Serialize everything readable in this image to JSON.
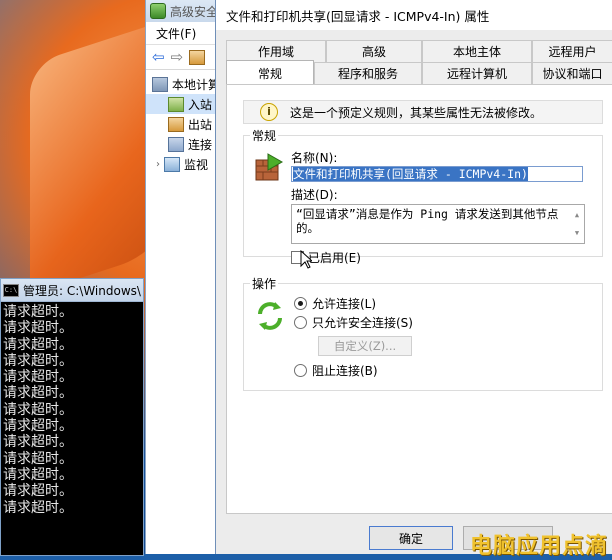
{
  "console": {
    "title": "管理员: C:\\Windows\\",
    "icon": "cmd-icon",
    "lines": [
      "请求超时。",
      "请求超时。",
      "请求超时。",
      "请求超时。",
      "请求超时。",
      "请求超时。",
      "请求超时。",
      "请求超时。",
      "请求超时。",
      "请求超时。",
      "请求超时。",
      "请求超时。",
      "请求超时。"
    ]
  },
  "mmc": {
    "title": "高级安全",
    "menu_file": "文件(F)",
    "tree": [
      {
        "label": "本地计算",
        "icon": "computer-icon"
      },
      {
        "label": "入站",
        "icon": "inbound-rules-icon"
      },
      {
        "label": "出站",
        "icon": "outbound-rules-icon"
      },
      {
        "label": "连接",
        "icon": "connection-security-icon"
      },
      {
        "label": "监视",
        "icon": "monitoring-icon"
      }
    ]
  },
  "dialog": {
    "title": "文件和打印机共享(回显请求 - ICMPv4-In) 属性",
    "tabs_back": [
      "作用域",
      "高级",
      "本地主体",
      "远程用户"
    ],
    "tabs_front": [
      "常规",
      "程序和服务",
      "远程计算机",
      "协议和端口"
    ],
    "active_tab": "常规",
    "info": "这是一个预定义规则，其某些属性无法被修改。",
    "general": {
      "legend": "常规",
      "name_label": "名称(N):",
      "name_value": "文件和打印机共享(回显请求 - ICMPv4-In)",
      "desc_label": "描述(D):",
      "desc_value": "“回显请求”消息是作为 Ping 请求发送到其他节点的。",
      "enabled_label": "已启用(E)",
      "enabled": false
    },
    "action": {
      "legend": "操作",
      "options": [
        "允许连接(L)",
        "只允许安全连接(S)",
        "阻止连接(B)"
      ],
      "selected": "允许连接(L)",
      "customize": "自定义(Z)..."
    },
    "ok_label": "确定"
  },
  "watermark": "电脑应用点滴",
  "colors": {
    "selection": "#3a74c4",
    "watermark": "#f0c22e"
  }
}
